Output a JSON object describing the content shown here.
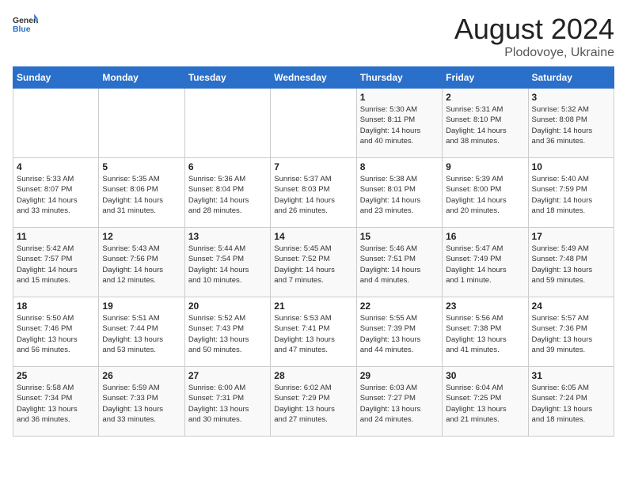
{
  "header": {
    "logo_general": "General",
    "logo_blue": "Blue",
    "month_year": "August 2024",
    "location": "Plodovoye, Ukraine"
  },
  "weekdays": [
    "Sunday",
    "Monday",
    "Tuesday",
    "Wednesday",
    "Thursday",
    "Friday",
    "Saturday"
  ],
  "weeks": [
    [
      {
        "day": "",
        "info": ""
      },
      {
        "day": "",
        "info": ""
      },
      {
        "day": "",
        "info": ""
      },
      {
        "day": "",
        "info": ""
      },
      {
        "day": "1",
        "info": "Sunrise: 5:30 AM\nSunset: 8:11 PM\nDaylight: 14 hours\nand 40 minutes."
      },
      {
        "day": "2",
        "info": "Sunrise: 5:31 AM\nSunset: 8:10 PM\nDaylight: 14 hours\nand 38 minutes."
      },
      {
        "day": "3",
        "info": "Sunrise: 5:32 AM\nSunset: 8:08 PM\nDaylight: 14 hours\nand 36 minutes."
      }
    ],
    [
      {
        "day": "4",
        "info": "Sunrise: 5:33 AM\nSunset: 8:07 PM\nDaylight: 14 hours\nand 33 minutes."
      },
      {
        "day": "5",
        "info": "Sunrise: 5:35 AM\nSunset: 8:06 PM\nDaylight: 14 hours\nand 31 minutes."
      },
      {
        "day": "6",
        "info": "Sunrise: 5:36 AM\nSunset: 8:04 PM\nDaylight: 14 hours\nand 28 minutes."
      },
      {
        "day": "7",
        "info": "Sunrise: 5:37 AM\nSunset: 8:03 PM\nDaylight: 14 hours\nand 26 minutes."
      },
      {
        "day": "8",
        "info": "Sunrise: 5:38 AM\nSunset: 8:01 PM\nDaylight: 14 hours\nand 23 minutes."
      },
      {
        "day": "9",
        "info": "Sunrise: 5:39 AM\nSunset: 8:00 PM\nDaylight: 14 hours\nand 20 minutes."
      },
      {
        "day": "10",
        "info": "Sunrise: 5:40 AM\nSunset: 7:59 PM\nDaylight: 14 hours\nand 18 minutes."
      }
    ],
    [
      {
        "day": "11",
        "info": "Sunrise: 5:42 AM\nSunset: 7:57 PM\nDaylight: 14 hours\nand 15 minutes."
      },
      {
        "day": "12",
        "info": "Sunrise: 5:43 AM\nSunset: 7:56 PM\nDaylight: 14 hours\nand 12 minutes."
      },
      {
        "day": "13",
        "info": "Sunrise: 5:44 AM\nSunset: 7:54 PM\nDaylight: 14 hours\nand 10 minutes."
      },
      {
        "day": "14",
        "info": "Sunrise: 5:45 AM\nSunset: 7:52 PM\nDaylight: 14 hours\nand 7 minutes."
      },
      {
        "day": "15",
        "info": "Sunrise: 5:46 AM\nSunset: 7:51 PM\nDaylight: 14 hours\nand 4 minutes."
      },
      {
        "day": "16",
        "info": "Sunrise: 5:47 AM\nSunset: 7:49 PM\nDaylight: 14 hours\nand 1 minute."
      },
      {
        "day": "17",
        "info": "Sunrise: 5:49 AM\nSunset: 7:48 PM\nDaylight: 13 hours\nand 59 minutes."
      }
    ],
    [
      {
        "day": "18",
        "info": "Sunrise: 5:50 AM\nSunset: 7:46 PM\nDaylight: 13 hours\nand 56 minutes."
      },
      {
        "day": "19",
        "info": "Sunrise: 5:51 AM\nSunset: 7:44 PM\nDaylight: 13 hours\nand 53 minutes."
      },
      {
        "day": "20",
        "info": "Sunrise: 5:52 AM\nSunset: 7:43 PM\nDaylight: 13 hours\nand 50 minutes."
      },
      {
        "day": "21",
        "info": "Sunrise: 5:53 AM\nSunset: 7:41 PM\nDaylight: 13 hours\nand 47 minutes."
      },
      {
        "day": "22",
        "info": "Sunrise: 5:55 AM\nSunset: 7:39 PM\nDaylight: 13 hours\nand 44 minutes."
      },
      {
        "day": "23",
        "info": "Sunrise: 5:56 AM\nSunset: 7:38 PM\nDaylight: 13 hours\nand 41 minutes."
      },
      {
        "day": "24",
        "info": "Sunrise: 5:57 AM\nSunset: 7:36 PM\nDaylight: 13 hours\nand 39 minutes."
      }
    ],
    [
      {
        "day": "25",
        "info": "Sunrise: 5:58 AM\nSunset: 7:34 PM\nDaylight: 13 hours\nand 36 minutes."
      },
      {
        "day": "26",
        "info": "Sunrise: 5:59 AM\nSunset: 7:33 PM\nDaylight: 13 hours\nand 33 minutes."
      },
      {
        "day": "27",
        "info": "Sunrise: 6:00 AM\nSunset: 7:31 PM\nDaylight: 13 hours\nand 30 minutes."
      },
      {
        "day": "28",
        "info": "Sunrise: 6:02 AM\nSunset: 7:29 PM\nDaylight: 13 hours\nand 27 minutes."
      },
      {
        "day": "29",
        "info": "Sunrise: 6:03 AM\nSunset: 7:27 PM\nDaylight: 13 hours\nand 24 minutes."
      },
      {
        "day": "30",
        "info": "Sunrise: 6:04 AM\nSunset: 7:25 PM\nDaylight: 13 hours\nand 21 minutes."
      },
      {
        "day": "31",
        "info": "Sunrise: 6:05 AM\nSunset: 7:24 PM\nDaylight: 13 hours\nand 18 minutes."
      }
    ]
  ]
}
